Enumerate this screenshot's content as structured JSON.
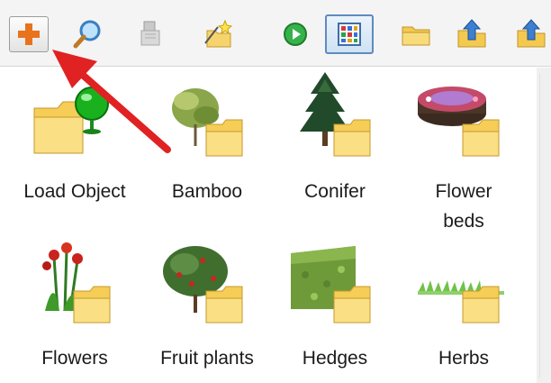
{
  "toolbar": {
    "buttons": [
      {
        "icon": "plus-icon"
      },
      {
        "icon": "magnifier-icon"
      },
      {
        "icon": "stack-icon"
      },
      {
        "icon": "new-folder-wand-icon"
      },
      {
        "icon": "play-icon"
      },
      {
        "icon": "grid-view-icon"
      },
      {
        "icon": "folder-icon"
      },
      {
        "icon": "folder-up-icon"
      },
      {
        "icon": "folder-up-icon"
      }
    ],
    "accent": "#e8731c"
  },
  "catalog": {
    "items": [
      {
        "label": "Load Object"
      },
      {
        "label": "Bamboo"
      },
      {
        "label": "Conifer"
      },
      {
        "label": "Flower\nbeds"
      },
      {
        "label": "Flowers"
      },
      {
        "label": "Fruit plants"
      },
      {
        "label": "Hedges"
      },
      {
        "label": "Herbs"
      }
    ]
  },
  "annotation": {
    "color": "#e02222"
  }
}
